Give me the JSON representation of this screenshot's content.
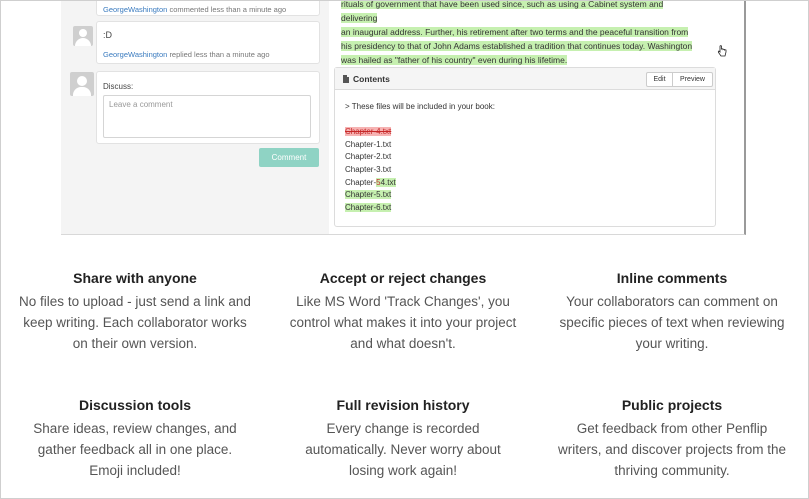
{
  "comments": [
    {
      "user": "GeorgeWashington",
      "text": "",
      "meta": "commented less than a minute ago"
    },
    {
      "user": "GeorgeWashington",
      "text": ":D",
      "meta": "replied less than a minute ago"
    }
  ],
  "discuss": {
    "label": "Discuss:",
    "placeholder": "Leave a comment",
    "button": "Comment"
  },
  "bio": {
    "line1": "rituals of government that have been used since, such as using a Cabinet system and delivering",
    "line2": "an inaugural address. Further, his retirement after two terms and the peaceful transition from",
    "line3": "his presidency to that of John Adams established a tradition that continues today. Washington",
    "line4": "was hailed as \"father of his country\" even during his lifetime."
  },
  "contents": {
    "title": "Contents",
    "edit_label": "Edit",
    "preview_label": "Preview",
    "intro": "> These files will be included in your book:",
    "files": {
      "deleted": "Chapter-4.txt",
      "f1": "Chapter-1.txt",
      "f2": "Chapter-2.txt",
      "f3": "Chapter-3.txt",
      "f4_prefix": "Chapter-",
      "f4_change": "5",
      "f4_suffix": "4.txt",
      "f5": "Chapter-5.txt",
      "f6_prefix": "Chapter-",
      "f6_change": "6",
      "f6_suffix": ".txt"
    }
  },
  "features": [
    {
      "title": "Share with anyone",
      "desc": [
        "No files to upload - just send a link and",
        "keep writing. Each collaborator works",
        "on their own version."
      ]
    },
    {
      "title": "Accept or reject changes",
      "desc": [
        "Like MS Word 'Track Changes', you",
        "control what makes it into your project",
        "and what doesn't."
      ]
    },
    {
      "title": "Inline comments",
      "desc": [
        "Your collaborators can comment on",
        "specific pieces of text when reviewing",
        "your writing."
      ]
    },
    {
      "title": "Discussion tools",
      "desc": [
        "Share ideas, review changes, and",
        "gather feedback all in one place.",
        "Emoji included!"
      ]
    },
    {
      "title": "Full revision history",
      "desc": [
        "Every change is recorded",
        "automatically. Never worry about",
        "losing work again!"
      ]
    },
    {
      "title": "Public projects",
      "desc": [
        "Get feedback from other Penflip",
        "writers, and discover projects from the",
        "thriving community."
      ]
    }
  ],
  "colors": {
    "accent": "#8fd3c4",
    "insert": "#c6f0b0",
    "delete": "#f6b3b3",
    "link": "#3a7bbf"
  }
}
